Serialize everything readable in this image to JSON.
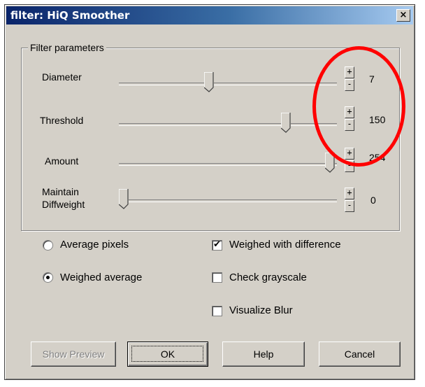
{
  "window": {
    "title": "filter: HiQ Smoother",
    "close_glyph": "×"
  },
  "group": {
    "legend": "Filter parameters"
  },
  "params": [
    {
      "label": "Diameter",
      "value": "7",
      "slider_fraction": 0.41
    },
    {
      "label": "Threshold",
      "value": "150",
      "slider_fraction": 0.78
    },
    {
      "label": "Amount",
      "value": "254",
      "slider_fraction": 0.99
    },
    {
      "label_line1": "Maintain",
      "label_line2": "Diffweight",
      "value": "0",
      "slider_fraction": 0.0
    }
  ],
  "spin": {
    "up": "+",
    "down": "-"
  },
  "radios": [
    {
      "label": "Average pixels",
      "selected": false
    },
    {
      "label": "Weighed average",
      "selected": true
    }
  ],
  "checkboxes": [
    {
      "label": "Weighed with difference",
      "checked": true
    },
    {
      "label": "Check grayscale",
      "checked": false
    },
    {
      "label": "Visualize Blur",
      "checked": false
    }
  ],
  "buttons": {
    "show_preview": "Show Preview",
    "ok": "OK",
    "help": "Help",
    "cancel": "Cancel"
  },
  "annotation_color": "#ff0000"
}
